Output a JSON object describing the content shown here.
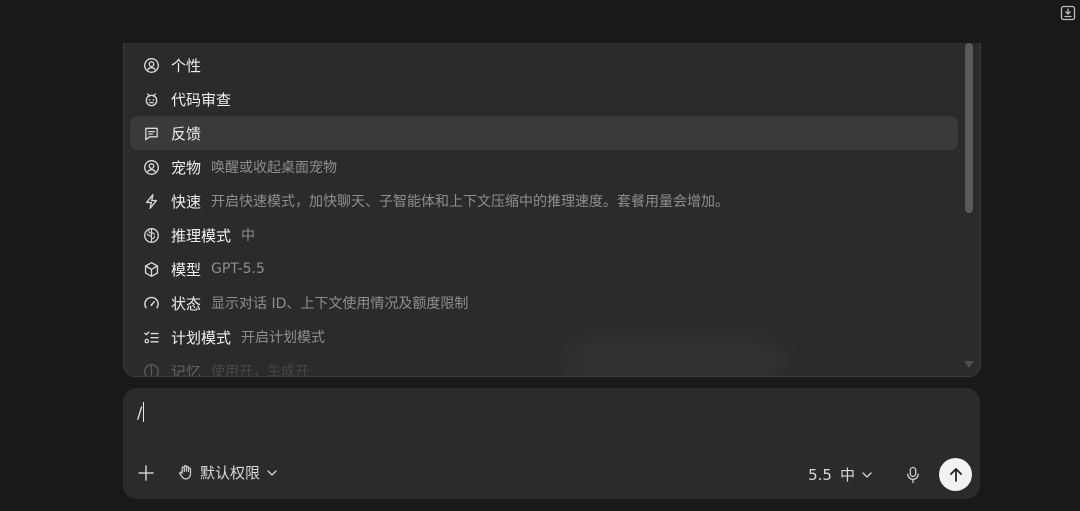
{
  "menu": {
    "items": [
      {
        "label": "个性",
        "desc": "",
        "icon": "user-circle-icon"
      },
      {
        "label": "代码审查",
        "desc": "",
        "icon": "bug-icon"
      },
      {
        "label": "反馈",
        "desc": "",
        "icon": "message-square-icon"
      },
      {
        "label": "宠物",
        "desc": "唤醒或收起桌面宠物",
        "icon": "pet-icon"
      },
      {
        "label": "快速",
        "desc": "开启快速模式，加快聊天、子智能体和上下文压缩中的推理速度。套餐用量会增加。",
        "icon": "lightning-icon"
      },
      {
        "label": "推理模式",
        "desc": "中",
        "icon": "brain-icon"
      },
      {
        "label": "模型",
        "desc": "GPT-5.5",
        "icon": "cube-icon"
      },
      {
        "label": "状态",
        "desc": "显示对话 ID、上下文使用情况及额度限制",
        "icon": "gauge-icon"
      },
      {
        "label": "计划模式",
        "desc": "开启计划模式",
        "icon": "checklist-icon"
      },
      {
        "label": "记忆",
        "desc": "使用开，生成开",
        "icon": "memory-icon"
      }
    ]
  },
  "composer": {
    "input_value": "/",
    "permission_label": "默认权限",
    "model_version": "5.5",
    "reasoning_level": "中"
  },
  "colors": {
    "background": "#191919",
    "panel": "#2b2b2b",
    "active_row": "#3a3a3a",
    "send_button": "#f2f2f2"
  }
}
